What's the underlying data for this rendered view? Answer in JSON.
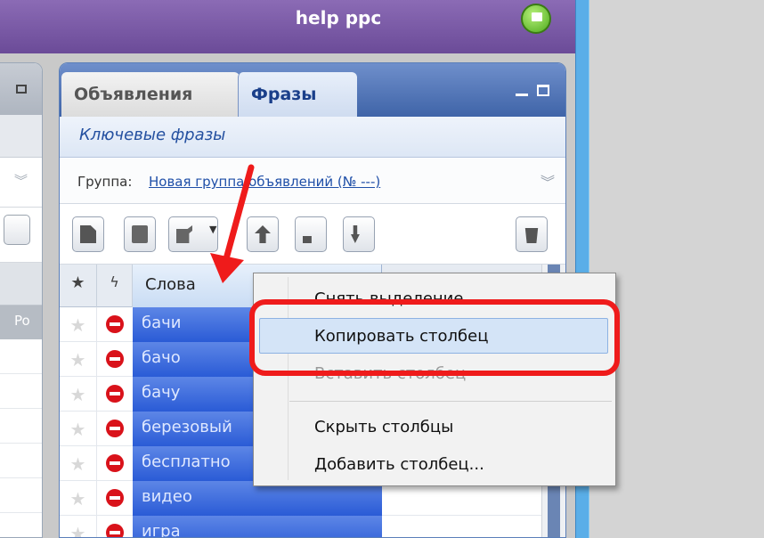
{
  "window": {
    "title": "help ppc"
  },
  "left_panel": {
    "row_label": "Po"
  },
  "panel": {
    "tabs": [
      {
        "label": "Объявления",
        "active": false
      },
      {
        "label": "Фразы",
        "active": true
      }
    ],
    "subtitle": "Ключевые фразы",
    "group": {
      "label": "Группа:",
      "link": "Новая группа объявлений (№ ---)"
    },
    "table": {
      "column_header": "Слова",
      "rows": [
        "бачи",
        "бачо",
        "бачу",
        "березовый",
        "бесплатно",
        "видео",
        "игра"
      ]
    }
  },
  "context_menu": {
    "items": [
      {
        "label": "Снять выделение",
        "disabled": false
      },
      {
        "label": "Копировать столбец",
        "highlighted": true
      },
      {
        "label": "Вставить столбец",
        "disabled": true
      },
      {
        "label": "Скрыть столбцы",
        "disabled": false
      },
      {
        "label": "Добавить столбец...",
        "disabled": false
      }
    ]
  },
  "colors": {
    "title_bar": "#7a5aa8",
    "tab_bar": "#4a6fb3",
    "selection": "#2a5bd6",
    "annotation": "#ef1b1b"
  },
  "icons": [
    "network-icon",
    "new-document-icon",
    "copy-icon",
    "edit-icon",
    "move-up-icon",
    "magic-wand-icon",
    "move-down-icon",
    "trash-icon",
    "star-icon",
    "lightning-icon",
    "stop-icon"
  ]
}
